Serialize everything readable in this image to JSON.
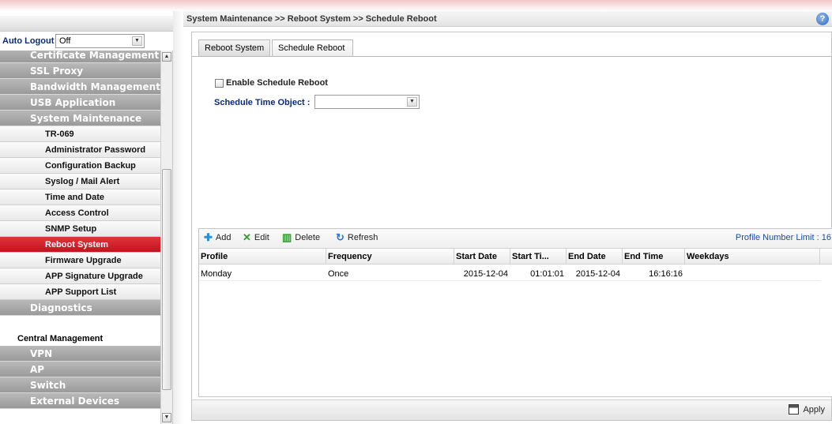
{
  "sidebar": {
    "auto_logout_label": "Auto Logout",
    "auto_logout_sep": ":",
    "auto_logout_value": "Off",
    "menu": [
      {
        "kind": "cat",
        "label": "Certificate Management"
      },
      {
        "kind": "cat",
        "label": "SSL Proxy"
      },
      {
        "kind": "cat",
        "label": "Bandwidth Management"
      },
      {
        "kind": "cat",
        "label": "USB Application"
      },
      {
        "kind": "cat",
        "label": "System Maintenance"
      },
      {
        "kind": "sub",
        "label": "TR-069"
      },
      {
        "kind": "sub",
        "label": "Administrator Password"
      },
      {
        "kind": "sub",
        "label": "Configuration Backup"
      },
      {
        "kind": "sub",
        "label": "Syslog / Mail Alert"
      },
      {
        "kind": "sub",
        "label": "Time and Date"
      },
      {
        "kind": "sub",
        "label": "Access Control"
      },
      {
        "kind": "sub",
        "label": "SNMP Setup"
      },
      {
        "kind": "sub",
        "label": "Reboot System",
        "active": true
      },
      {
        "kind": "sub",
        "label": "Firmware Upgrade"
      },
      {
        "kind": "sub",
        "label": "APP Signature Upgrade"
      },
      {
        "kind": "sub",
        "label": "APP Support List"
      },
      {
        "kind": "cat",
        "label": "Diagnostics"
      },
      {
        "kind": "blank",
        "label": ""
      },
      {
        "kind": "plain",
        "label": "Central Management"
      },
      {
        "kind": "cat",
        "label": "VPN"
      },
      {
        "kind": "cat",
        "label": "AP"
      },
      {
        "kind": "cat",
        "label": "Switch"
      },
      {
        "kind": "cat",
        "label": "External Devices"
      }
    ]
  },
  "header": {
    "breadcrumb": "System Maintenance >> Reboot System >> Schedule Reboot",
    "help": "?"
  },
  "tabs": {
    "reboot_system": "Reboot System",
    "schedule_reboot": "Schedule Reboot",
    "active": "Schedule Reboot"
  },
  "form": {
    "enable_label": "Enable Schedule Reboot",
    "enable_checked": false,
    "schedule_time_label": "Schedule Time Object :",
    "schedule_time_value": ""
  },
  "toolbar": {
    "add": "Add",
    "edit": "Edit",
    "delete": "Delete",
    "refresh": "Refresh",
    "profile_limit_label": "Profile Number Limit :",
    "profile_limit_value": "16"
  },
  "table": {
    "columns": [
      "Profile",
      "Frequency",
      "Start Date",
      "Start Ti...",
      "End Date",
      "End Time",
      "Weekdays"
    ],
    "rows": [
      [
        "Monday",
        "Once",
        "2015-12-04",
        "01:01:01",
        "2015-12-04",
        "16:16:16",
        ""
      ]
    ]
  },
  "footer": {
    "apply": "Apply"
  },
  "colors": {
    "active_menu": "#d0222a",
    "category_menu": "#a8a8a8",
    "label_blue": "#0a2a7a",
    "accent_blue": "#1a4fa0"
  },
  "icons": {
    "add": "add-icon",
    "edit": "edit-icon",
    "delete": "delete-icon",
    "refresh": "refresh-icon",
    "apply": "save-icon",
    "help": "help-icon"
  }
}
